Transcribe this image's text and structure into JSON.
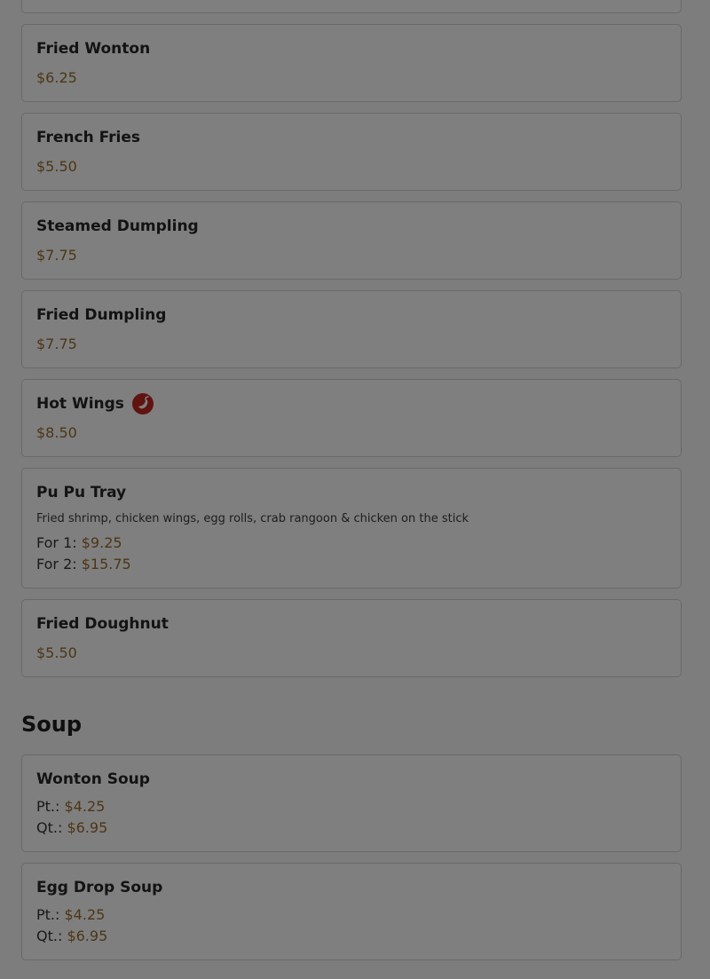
{
  "appetizers": [
    {
      "name": "Fried Wonton",
      "price": "$6.25"
    },
    {
      "name": "French Fries",
      "price": "$5.50"
    },
    {
      "name": "Steamed Dumpling",
      "price": "$7.75"
    },
    {
      "name": "Fried Dumpling",
      "price": "$7.75"
    },
    {
      "name": "Hot Wings",
      "price": "$8.50",
      "spicy_icon": "chili-pepper-icon"
    },
    {
      "name": "Pu Pu Tray",
      "description": "Fried shrimp, chicken wings, egg rolls, crab rangoon & chicken on the stick",
      "prices": [
        {
          "label": "For 1:",
          "price": "$9.25"
        },
        {
          "label": "For 2:",
          "price": "$15.75"
        }
      ]
    },
    {
      "name": "Fried Doughnut",
      "price": "$5.50"
    }
  ],
  "soup": {
    "title": "Soup",
    "items": [
      {
        "name": "Wonton Soup",
        "prices": [
          {
            "label": "Pt.:",
            "price": "$4.25"
          },
          {
            "label": "Qt.:",
            "price": "$6.95"
          }
        ]
      },
      {
        "name": "Egg Drop Soup",
        "prices": [
          {
            "label": "Pt.:",
            "price": "$4.25"
          },
          {
            "label": "Qt.:",
            "price": "$6.95"
          }
        ]
      }
    ]
  },
  "colors": {
    "price": "#9a6d2a",
    "spicy_badge": "#c0261f",
    "overlay": "rgba(0,0,0,0.5)"
  }
}
